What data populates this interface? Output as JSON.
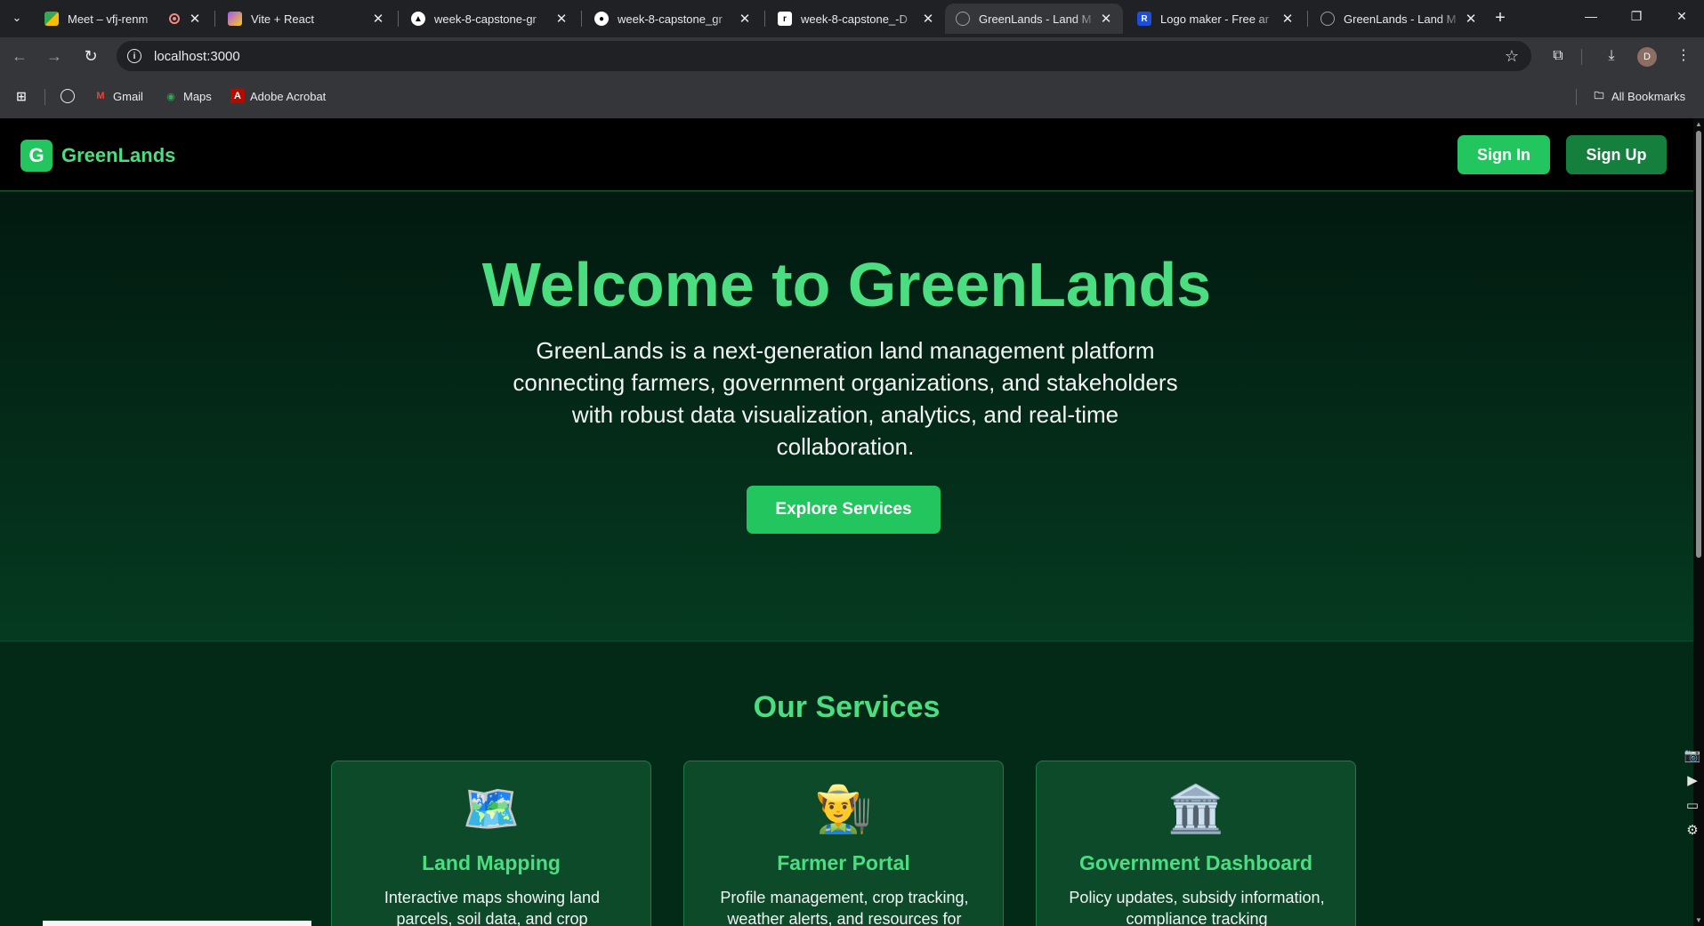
{
  "browser": {
    "tabs": [
      {
        "title": "Meet – vfj-renm",
        "favicon": "meet-icon",
        "recording": true
      },
      {
        "title": "Vite + React",
        "favicon": "vite-icon"
      },
      {
        "title": "week-8-capstone-gr",
        "favicon": "vercel-icon"
      },
      {
        "title": "week-8-capstone_gr",
        "favicon": "github-icon"
      },
      {
        "title": "week-8-capstone_-D",
        "favicon": "render-icon"
      },
      {
        "title": "GreenLands - Land M",
        "favicon": "globe-icon",
        "active": true
      },
      {
        "title": "Logo maker - Free ar",
        "favicon": "logo-maker-icon"
      },
      {
        "title": "GreenLands - Land M",
        "favicon": "globe-icon"
      }
    ],
    "url": "localhost:3000",
    "avatar_letter": "D",
    "bookmarks": [
      {
        "label": "Gmail",
        "icon": "gmail-icon"
      },
      {
        "label": "Maps",
        "icon": "maps-icon"
      },
      {
        "label": "Adobe Acrobat",
        "icon": "acrobat-icon"
      }
    ],
    "all_bookmarks": "All Bookmarks"
  },
  "nav": {
    "logo_letter": "G",
    "brand": "GreenLands",
    "signin": "Sign In",
    "signup": "Sign Up"
  },
  "hero": {
    "title": "Welcome to GreenLands",
    "description": "GreenLands is a next-generation land management platform connecting farmers, government organizations, and stakeholders with robust data visualization, analytics, and real-time collaboration.",
    "cta": "Explore Services"
  },
  "services": {
    "title": "Our Services",
    "cards": [
      {
        "icon": "🗺️",
        "icon_name": "map-icon",
        "title": "Land Mapping",
        "desc": "Interactive maps showing land parcels, soil data, and crop"
      },
      {
        "icon": "👨‍🌾",
        "icon_name": "farmer-icon",
        "title": "Farmer Portal",
        "desc": "Profile management, crop tracking, weather alerts, and resources for"
      },
      {
        "icon": "🏛️",
        "icon_name": "government-building-icon",
        "title": "Government Dashboard",
        "desc": "Policy updates, subsidy information, compliance tracking"
      }
    ]
  },
  "colors": {
    "accent": "#22c55e",
    "accent_text": "#4ade80",
    "signup": "#15803d",
    "card_bg": "#0d4a2a"
  }
}
